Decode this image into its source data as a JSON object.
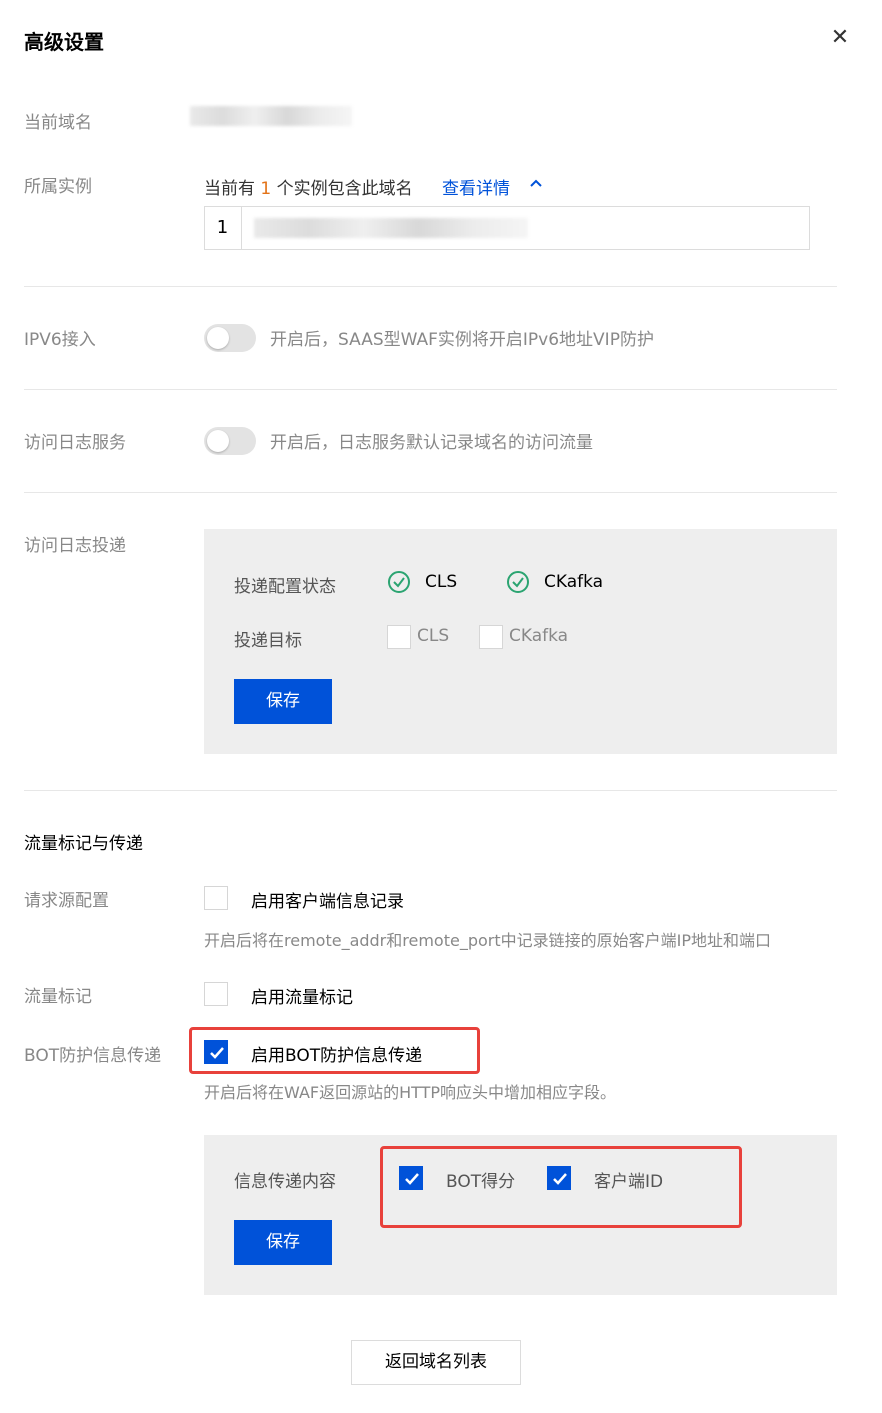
{
  "dialog": {
    "title": "高级设置",
    "close_icon": "close-icon"
  },
  "domain": {
    "label": "当前域名"
  },
  "instance": {
    "label": "所属实例",
    "prefix": "当前有",
    "count": "1",
    "suffix": "个实例包含此域名",
    "details_link": "查看详情",
    "list_index": "1"
  },
  "ipv6": {
    "label": "IPV6接入",
    "description": "开启后，SAAS型WAF实例将开启IPv6地址VIP防护",
    "enabled": false
  },
  "access_log": {
    "label": "访问日志服务",
    "description": "开启后，日志服务默认记录域名的访问流量",
    "enabled": false
  },
  "log_delivery": {
    "label": "访问日志投递",
    "status_label": "投递配置状态",
    "status_items": [
      "CLS",
      "CKafka"
    ],
    "target_label": "投递目标",
    "target_items": [
      "CLS",
      "CKafka"
    ],
    "save": "保存"
  },
  "traffic": {
    "section_title": "流量标记与传递",
    "source": {
      "label": "请求源配置",
      "checkbox_label": "启用客户端信息记录",
      "hint": "开启后将在remote_addr和remote_port中记录链接的原始客户端IP地址和端口"
    },
    "mark": {
      "label": "流量标记",
      "checkbox_label": "启用流量标记"
    },
    "bot": {
      "label": "BOT防护信息传递",
      "checkbox_label": "启用BOT防护信息传递",
      "hint": "开启后将在WAF返回源站的HTTP响应头中增加相应字段。",
      "content_label": "信息传递内容",
      "options": [
        "BOT得分",
        "客户端ID"
      ],
      "save": "保存"
    }
  },
  "footer": {
    "back_button": "返回域名列表"
  },
  "colors": {
    "primary": "#0052d9",
    "success": "#2ba471",
    "highlight": "#e8413b",
    "count": "#e37318"
  }
}
